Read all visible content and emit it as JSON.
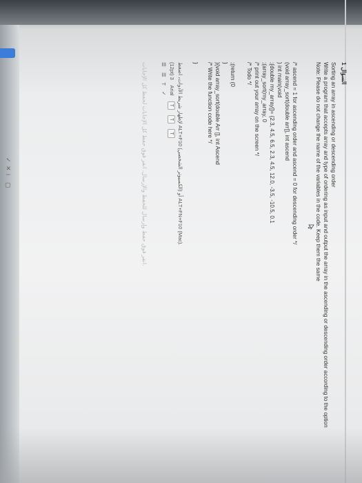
{
  "question": {
    "label": "السؤال 1",
    "title": "Sorting an array in ascending or descending order",
    "instructions": "Write a program that accepts array and type of ordering as input and output the array in the ascending or descending order according to the option",
    "note": "Note: Please do not change the name of the variables in the code. Keep them the same"
  },
  "code": [
    "/* ascend = 1 for ascending order and ascend = 0 for descending order */",
    "(void array_sort(double arr[], int ascend",
    ") int main(void",
    ";{double my_array[]= {2.3, 4.5, 6.5, 2.3, 4.5, 12.0, -3.5, -10.5, 0.1",
    ";(array_sort(my_array, 0",
    "/* print out your array on the screen */",
    "/* Todo */",
    ";(return (0",
    "}",
    "){void array_sort(double Arr [], int Ascend",
    "/* Write the function code here */",
    "}"
  ],
  "toolbar": {
    "hint": "لإظهار شريط الأدوات، اضغط ALT+F10 (الكمبيوتر الشخصي) أو ALT+FN+F10 (Mac).",
    "font_size": "(12pt) 3",
    "font_family": "Arial",
    "format_buttons": [
      "T",
      "T",
      "T"
    ],
    "list_buttons": [
      "☰",
      "☰",
      "T",
      "✓"
    ],
    "faded_text": "انقر فوق حفظ وإرسال للحفظ والإرسال. انقر فوق حفظ كل الإجابات لحفظ كل الإجابات."
  },
  "side_icons": [
    "✓",
    "✕",
    "i",
    "▢"
  ]
}
